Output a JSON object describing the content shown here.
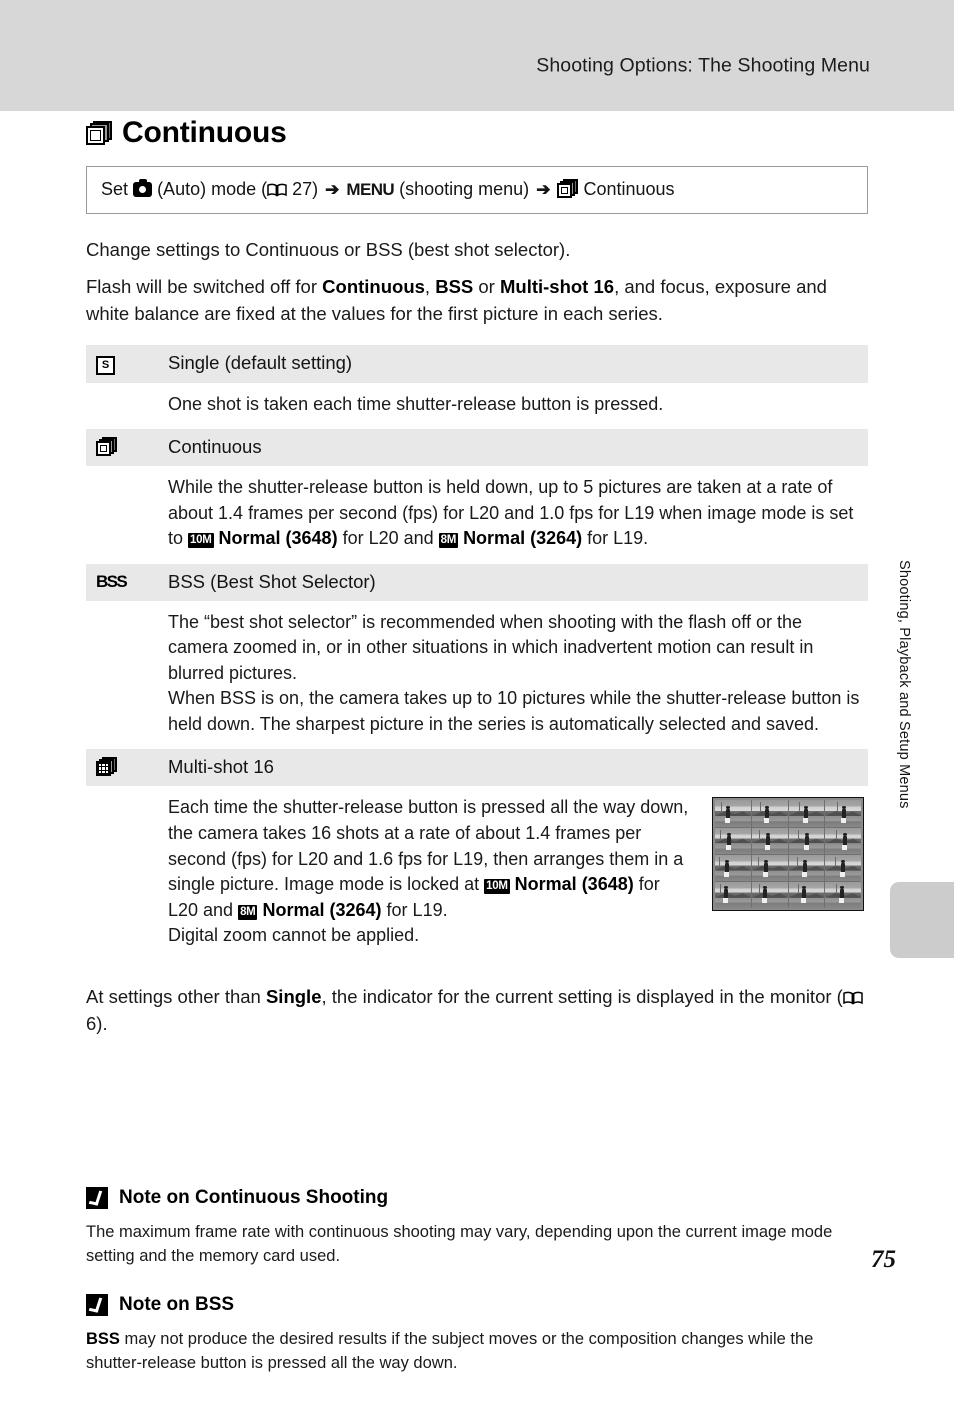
{
  "header": {
    "running_title": "Shooting Options: The Shooting Menu",
    "band_color": "#d7d7d7"
  },
  "side_tab": {
    "label": "Shooting, Playback and Setup Menus",
    "block_color": "#cccccc"
  },
  "section": {
    "icon": "continuous-stack-icon",
    "title": "Continuous"
  },
  "path_box": {
    "set_word": "Set",
    "camera_icon": "camera-auto-icon",
    "auto_mode": "(Auto) mode (",
    "book_icon": "book-page-ref-icon",
    "page_ref": "27)",
    "arrow": "➔",
    "menu_word": "MENU",
    "menu_suffix": "(shooting menu)",
    "arrow2": "➔",
    "continuous_icon": "continuous-stack-icon",
    "destination": "Continuous"
  },
  "intro": {
    "line1": "Change settings to Continuous or BSS (best shot selector).",
    "line2_a": "Flash will be switched off for ",
    "line2_b1": "Continuous",
    "line2_sep1": ", ",
    "line2_b2": "BSS",
    "line2_sep2": " or ",
    "line2_b3": "Multi-shot 16",
    "line2_c": ", and focus, exposure and white balance are fixed at the values for the first picture in each series."
  },
  "options": [
    {
      "icon": "single-shot-icon",
      "label": "Single (default setting)",
      "description": "One shot is taken each time shutter-release button is pressed."
    },
    {
      "icon": "continuous-stack-icon",
      "label": "Continuous",
      "desc_part1": "While the shutter-release button is held down, up to 5 pictures are taken at a rate of about 1.4 frames per second (fps) for L20 and 1.0 fps for L19 when image mode is set to ",
      "chip1": "10M",
      "desc_bold1": "Normal (3648)",
      "desc_part2": " for L20 and ",
      "chip2": "8M",
      "desc_bold2": "Normal (3264)",
      "desc_part3": " for L19."
    },
    {
      "icon": "bss-icon",
      "icon_text": "BSS",
      "label": "BSS (Best Shot Selector)",
      "description": "The “best shot selector” is recommended when shooting with the flash off or the camera zoomed in, or in other situations in which inadvertent motion can result in blurred pictures.",
      "description2": "When BSS is on, the camera takes up to 10 pictures while the shutter-release button is held down. The sharpest picture in the series is automatically selected and saved."
    },
    {
      "icon": "multi-shot-16-icon",
      "label": "Multi-shot 16",
      "desc_part1": "Each time the shutter-release button is pressed all the way down, the camera takes 16 shots at a rate of about 1.4 frames per second (fps) for L20 and 1.6 fps for L19, then arranges them in a single picture. Image mode is locked at ",
      "chip1": "10M",
      "desc_bold1": "Normal (3648)",
      "desc_part2": " for L20 and ",
      "chip2": "8M",
      "desc_bold2": "Normal (3264)",
      "desc_part3": " for L19.",
      "desc_part4": "Digital zoom cannot be applied.",
      "figure": "multi-shot-16-sample-image"
    }
  ],
  "after_table": {
    "a": "At settings other than ",
    "b": "Single",
    "c": ", the indicator for the current setting is displayed in the monitor (",
    "book_icon": "book-page-ref-icon",
    "page_ref": "6)."
  },
  "notes": [
    {
      "icon": "caution-check-icon",
      "title": "Note on Continuous Shooting",
      "body": "The maximum frame rate with continuous shooting may vary, depending upon the current image mode setting and the memory card used."
    },
    {
      "icon": "caution-check-icon",
      "title": "Note on BSS",
      "body_bold": "BSS",
      "body": " may not produce the desired results if the subject moves or the composition changes while the shutter-release button is pressed all the way down."
    }
  ],
  "page_number": "75"
}
